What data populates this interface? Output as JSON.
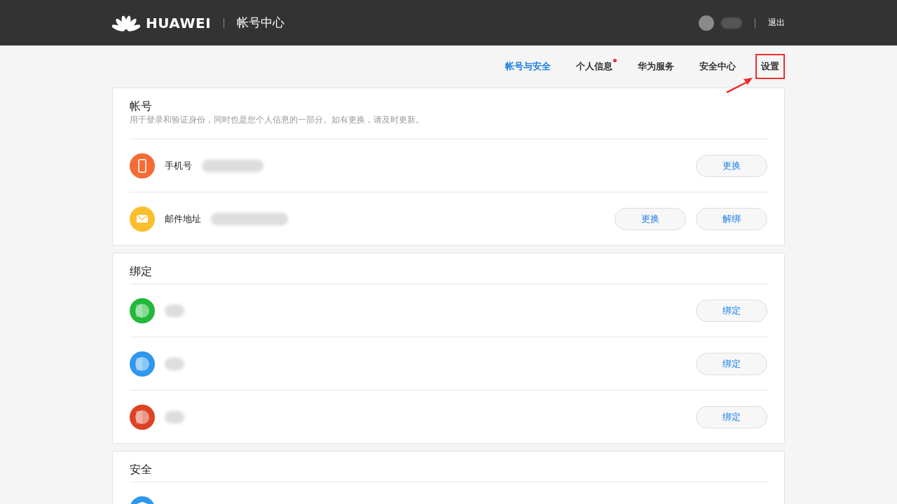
{
  "header": {
    "brand": "HUAWEI",
    "title": "帐号中心",
    "logout": "退出"
  },
  "nav": [
    {
      "label": "帐号与安全",
      "selected": true,
      "dot": false,
      "highlighted": false
    },
    {
      "label": "个人信息",
      "selected": false,
      "dot": true,
      "highlighted": false
    },
    {
      "label": "华为服务",
      "selected": false,
      "dot": false,
      "highlighted": false
    },
    {
      "label": "安全中心",
      "selected": false,
      "dot": false,
      "highlighted": false
    },
    {
      "label": "设置",
      "selected": false,
      "dot": false,
      "highlighted": true
    }
  ],
  "sections": [
    {
      "title": "帐号",
      "subtitle": "用于登录和验证身份，同时也是您个人信息的一部分。如有更换，请及时更新。",
      "rows": [
        {
          "kind": "phone",
          "label": "手机号",
          "color": "#f46b35",
          "buttons": [
            "更换"
          ]
        },
        {
          "kind": "mail",
          "label": "邮件地址",
          "color": "#fbbf2d",
          "buttons": [
            "更换",
            "解绑"
          ]
        }
      ]
    },
    {
      "title": "绑定",
      "rows": [
        {
          "kind": "app",
          "color": "#22b83a",
          "buttons": [
            "绑定"
          ]
        },
        {
          "kind": "app",
          "color": "#2f97ec",
          "buttons": [
            "绑定"
          ]
        },
        {
          "kind": "app",
          "color": "#dd4224",
          "buttons": [
            "绑定"
          ]
        }
      ]
    },
    {
      "title": "安全",
      "rows": [
        {
          "kind": "shield",
          "color": "#2f97ec",
          "buttons": []
        }
      ]
    }
  ]
}
